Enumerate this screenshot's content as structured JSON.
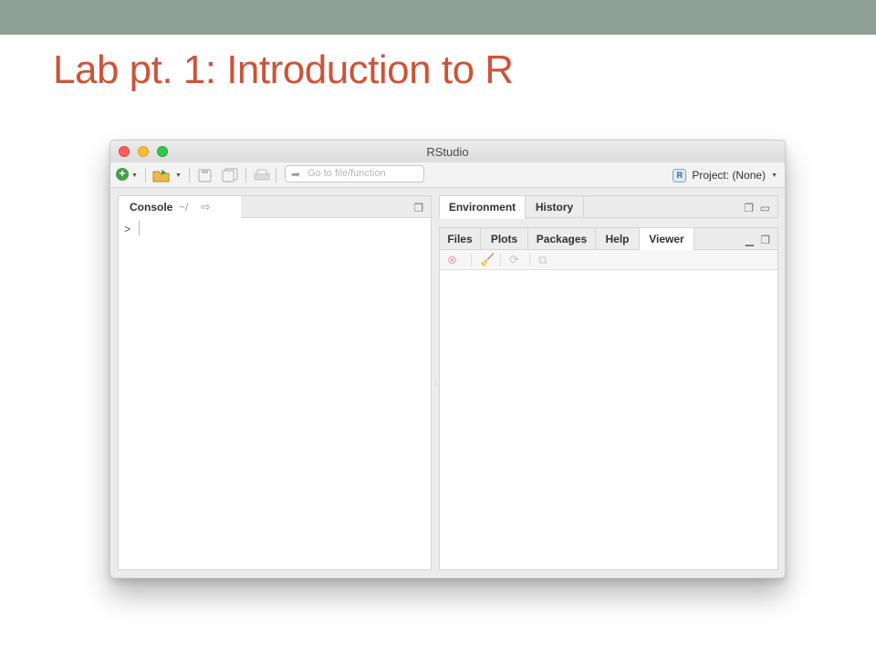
{
  "slide": {
    "title": "Lab pt. 1: Introduction to R"
  },
  "window": {
    "title": "RStudio"
  },
  "toolbar": {
    "goto_placeholder": "Go to file/function",
    "project_label": "Project: (None)",
    "project_icon_letter": "R"
  },
  "console": {
    "tab_label": "Console",
    "path": "~/",
    "prompt": ">"
  },
  "env_pane": {
    "tabs": [
      {
        "label": "Environment"
      },
      {
        "label": "History"
      }
    ]
  },
  "files_pane": {
    "tabs": [
      {
        "label": "Files"
      },
      {
        "label": "Plots"
      },
      {
        "label": "Packages"
      },
      {
        "label": "Help"
      },
      {
        "label": "Viewer",
        "active": true
      }
    ]
  },
  "colors": {
    "slide_bar": "#8fa197",
    "title": "#cc5438",
    "close": "#fc5f57",
    "minimize": "#fdbc2e",
    "maximize": "#34c84a"
  }
}
